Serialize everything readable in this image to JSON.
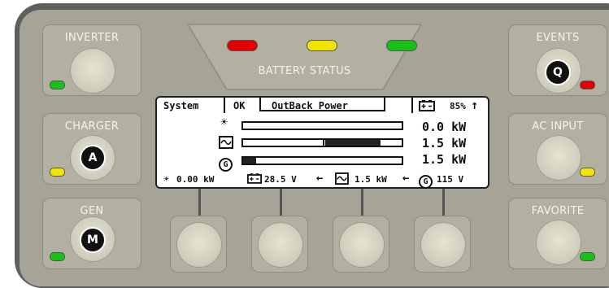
{
  "buttons": {
    "inverter": {
      "label": "INVERTER"
    },
    "charger": {
      "label": "CHARGER",
      "badge": "A"
    },
    "gen": {
      "label": "GEN",
      "badge": "M"
    },
    "events": {
      "label": "EVENTS",
      "badge": "Q"
    },
    "ac_input": {
      "label": "AC INPUT"
    },
    "favorite": {
      "label": "FAVORITE"
    }
  },
  "battery_status": {
    "label": "BATTERY STATUS",
    "leds": [
      "#e00000",
      "#f2e600",
      "#19c019"
    ]
  },
  "led_colors": {
    "inverter": "#19c019",
    "charger": "#f2e600",
    "gen": "#19c019",
    "events": "#e00000",
    "ac_input": "#f2e600",
    "favorite": "#19c019"
  },
  "lcd": {
    "tabs": {
      "system": "System",
      "status": "OK",
      "name": "OutBack Power"
    },
    "battery_percent": "85%",
    "rows": [
      {
        "icon": "sun-icon",
        "value": "0.0 kW",
        "level": 0
      },
      {
        "icon": "ac-wave-icon",
        "value": "1.5 kW",
        "level": 0.35
      },
      {
        "icon": "generator-icon",
        "value": "1.5 kW",
        "level": 0.08
      }
    ],
    "footer": {
      "solar": "0.00 kW",
      "battery": "28.5 V",
      "load": "1.5 kW",
      "gen": "115 V"
    }
  }
}
